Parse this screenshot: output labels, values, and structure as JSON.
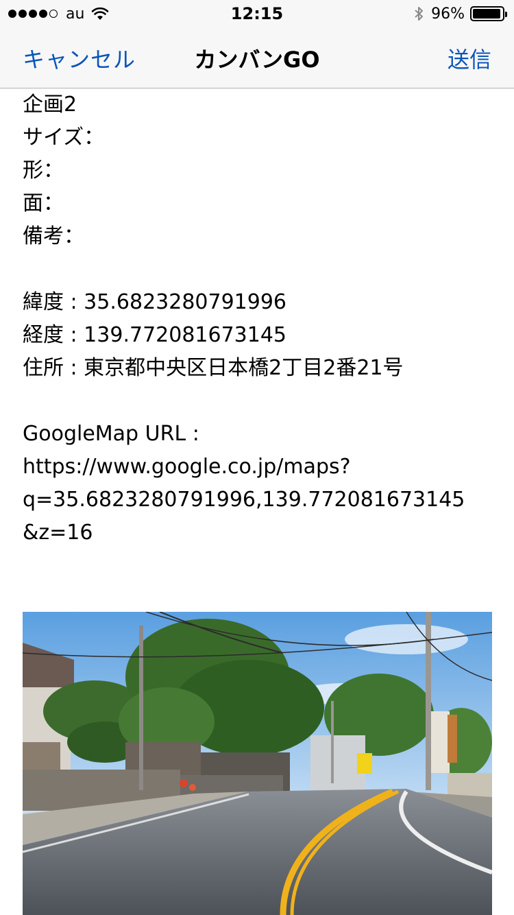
{
  "status_bar": {
    "carrier": "au",
    "time": "12:15",
    "battery_percent_label": "96%",
    "battery_level": 0.96,
    "signal_bars_filled": 4,
    "signal_bars_total": 5,
    "icons": [
      "wifi-icon",
      "bluetooth-icon",
      "battery-icon"
    ]
  },
  "nav": {
    "cancel_label": "キャンセル",
    "title": "カンバンGO",
    "send_label": "送信",
    "accent_color": "#0a55b8"
  },
  "message": {
    "line1": "企画2",
    "size_label": "サイズ：",
    "shape_label": "形：",
    "face_label": "面：",
    "notes_label": "備考：",
    "latitude_line": "緯度 : 35.6823280791996",
    "longitude_line": "経度 : 139.772081673145",
    "address_line": "住所 : 東京都中央区日本橋2丁目2番21号",
    "map_label": "GoogleMap URL :",
    "url_line1": "https://www.google.co.jp/maps?",
    "url_line2": "q=35.6823280791996,139.772081673145",
    "url_line3": "&z=16"
  },
  "attachment": {
    "type": "photo",
    "subject": "street-scene"
  }
}
